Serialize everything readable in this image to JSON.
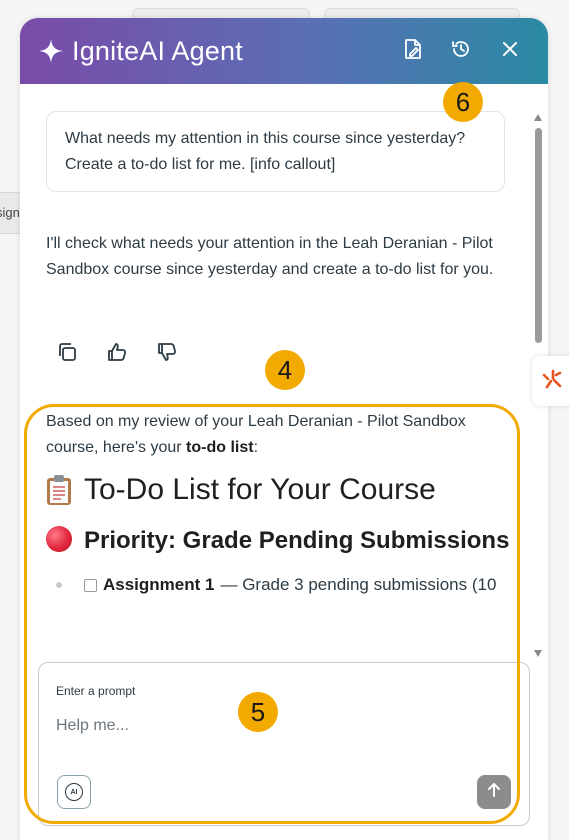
{
  "background": {
    "tab_fragment": "sign"
  },
  "panel": {
    "title": "IgniteAI Agent",
    "header_icons": [
      "document-edit-icon",
      "history-icon",
      "close-icon"
    ]
  },
  "conversation": {
    "user_message": "What needs my attention in this course since yesterday? Create a to-do list for me. [info callout]",
    "assistant_message": "I'll check what needs your attention in the Leah Deranian - Pilot Sandbox course since yesterday and create a to-do list for you.",
    "action_icons": [
      "copy-icon",
      "thumbs-up-icon",
      "thumbs-down-icon"
    ]
  },
  "response": {
    "intro_prefix": "Based on my review of your Leah Deranian - Pilot Sandbox course, here's your ",
    "intro_bold": "to-do list",
    "intro_suffix": ":",
    "heading": "To-Do List for Your Course",
    "priority_heading": "Priority: Grade Pending Submissions",
    "items": [
      {
        "title": "Assignment 1",
        "text": "— Grade 3 pending submissions (10"
      }
    ]
  },
  "prompt": {
    "label": "Enter a prompt",
    "placeholder": "Help me...",
    "ai_label": "AI"
  },
  "callouts": {
    "badge_4": "4",
    "badge_5": "5",
    "badge_6": "6",
    "color": "#f2a900"
  },
  "colors": {
    "header_start": "#7a4ba9",
    "header_end": "#2a8aa3",
    "priority_dot": "#e0283d"
  }
}
